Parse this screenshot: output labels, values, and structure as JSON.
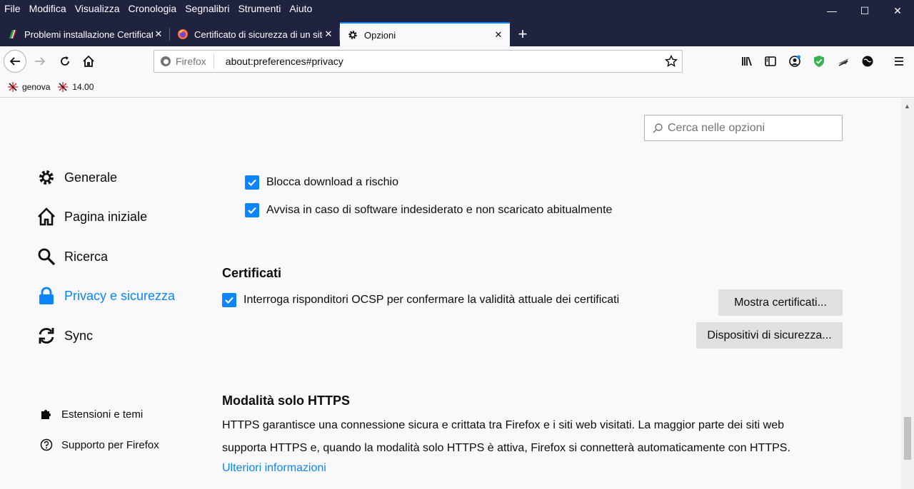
{
  "menu": [
    "File",
    "Modifica",
    "Visualizza",
    "Cronologia",
    "Segnalibri",
    "Strumenti",
    "Aiuto"
  ],
  "window_controls": {
    "minimize": "—",
    "maximize": "☐",
    "close": "✕"
  },
  "tabs": [
    {
      "title": "Problemi installazione Certificato",
      "icon": "italy-flag-icon"
    },
    {
      "title": "Certificato di sicurezza di un sito",
      "icon": "firefox-icon"
    },
    {
      "title": "Opzioni",
      "icon": "gear-icon"
    }
  ],
  "new_tab": "+",
  "urlbar": {
    "identity": "Firefox",
    "url": "about:preferences#privacy"
  },
  "bookmarks": [
    {
      "label": "genova",
      "icon": "weather-icon"
    },
    {
      "label": "14.00",
      "icon": "weather-icon"
    }
  ],
  "search": {
    "placeholder": "Cerca nelle opzioni"
  },
  "categories": {
    "general": "Generale",
    "home": "Pagina iniziale",
    "search": "Ricerca",
    "privacy": "Privacy e sicurezza",
    "sync": "Sync"
  },
  "footer_links": {
    "extensions": "Estensioni e temi",
    "support": "Supporto per Firefox"
  },
  "security": {
    "block_downloads": "Blocca download a rischio",
    "warn_unwanted": "Avvisa in caso di software indesiderato e non scaricato abitualmente"
  },
  "certificates": {
    "heading": "Certificati",
    "ocsp": "Interroga risponditori OCSP per confermare la validità attuale dei certificati",
    "show_button": "Mostra certificati...",
    "devices_button": "Dispositivi di sicurezza..."
  },
  "https": {
    "heading": "Modalità solo HTTPS",
    "line1": "HTTPS garantisce una connessione sicura e crittata tra Firefox e i siti web visitati. La maggior parte dei siti web",
    "line2": "supporta HTTPS e, quando la modalità solo HTTPS è attiva, Firefox si connetterà automaticamente con HTTPS.",
    "learn_more": "Ulteriori informazioni"
  },
  "colors": {
    "accent": "#0a84ff",
    "titlebar": "#202340",
    "shield": "#38b24f"
  }
}
